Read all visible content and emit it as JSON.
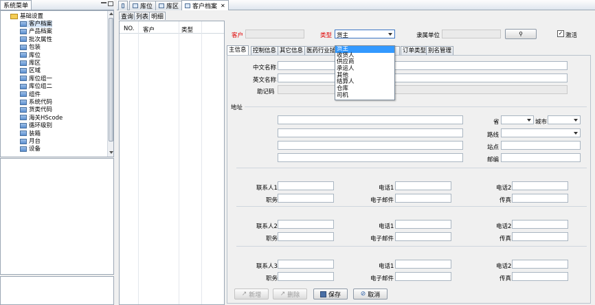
{
  "left": {
    "title": "系统菜单",
    "tree_root": "基础设置",
    "tree_items": [
      "客户档案",
      "产品档案",
      "批次属性",
      "包装",
      "库位",
      "库区",
      "区域",
      "库位组一",
      "库位组二",
      "组件",
      "系统代码",
      "货类代码",
      "海关HScode",
      "循环级别",
      "装箱",
      "月台",
      "设备"
    ]
  },
  "editor_tabs": [
    {
      "label": ""
    },
    {
      "label": "库位"
    },
    {
      "label": "库区"
    },
    {
      "label": "客户档案"
    }
  ],
  "view_tabs": [
    "查询",
    "列表",
    "明细"
  ],
  "list_columns": [
    "NO.",
    "客户",
    "类型"
  ],
  "top": {
    "customer_label": "客户",
    "type_label": "类型",
    "type_value": "货主",
    "belong_label": "隶属单位",
    "active_label": "激活"
  },
  "type_options": [
    "货主",
    "收货人",
    "供应商",
    "承运人",
    "其他",
    "结算人",
    "仓库",
    "司机"
  ],
  "type_selected_index": 0,
  "sub_tabs": [
    "主信息",
    "控制信息",
    "其它信息",
    "医药行业插",
    "",
    "订单类型",
    "别名管理"
  ],
  "main": {
    "cn_name": "中文名称",
    "en_name": "英文名称",
    "mnemonic": "助记码",
    "address": "地址",
    "province": "省",
    "city": "城市",
    "route": "路线",
    "station": "站点",
    "zip": "邮编"
  },
  "contacts": [
    {
      "contact": "联系人1",
      "job": "职务",
      "phone1": "电话1",
      "email": "电子邮件",
      "phone2": "电话2",
      "fax": "传真"
    },
    {
      "contact": "联系人2",
      "job": "职务",
      "phone1": "电话1",
      "email": "电子邮件",
      "phone2": "电话2",
      "fax": "传真"
    },
    {
      "contact": "联系人3",
      "job": "职务",
      "phone1": "电话1",
      "email": "电子邮件",
      "phone2": "电话2",
      "fax": "传真"
    }
  ],
  "buttons": {
    "add": "新增",
    "delete": "删除",
    "save": "保存",
    "cancel": "取消"
  },
  "colors": {
    "required_label": "#e00000",
    "selection": "#3399ff",
    "accent_border": "#9aa6b4"
  }
}
